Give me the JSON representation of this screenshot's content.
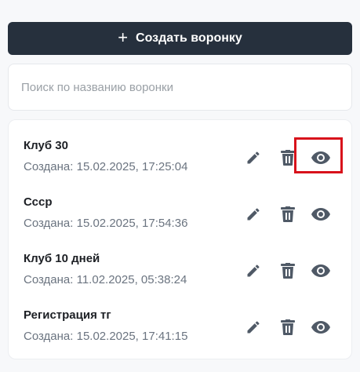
{
  "create_button": {
    "icon": "plus-icon",
    "label": "Создать воронку"
  },
  "search": {
    "placeholder": "Поиск по названию воронки",
    "value": ""
  },
  "funnels": [
    {
      "name": "Клуб 30",
      "created": "Создана: 15.02.2025, 17:25:04"
    },
    {
      "name": "Ссср",
      "created": "Создана: 15.02.2025, 17:54:36"
    },
    {
      "name": "Клуб 10 дней",
      "created": "Создана: 11.02.2025, 05:38:24"
    },
    {
      "name": "Регистрация тг",
      "created": "Создана: 15.02.2025, 17:41:15"
    }
  ],
  "row_actions": {
    "edit_icon": "pencil-icon",
    "delete_icon": "trash-icon",
    "view_icon": "eye-icon"
  },
  "colors": {
    "primary_button": "#26303d",
    "icon": "#4f5966",
    "highlight": "#d8121b"
  }
}
